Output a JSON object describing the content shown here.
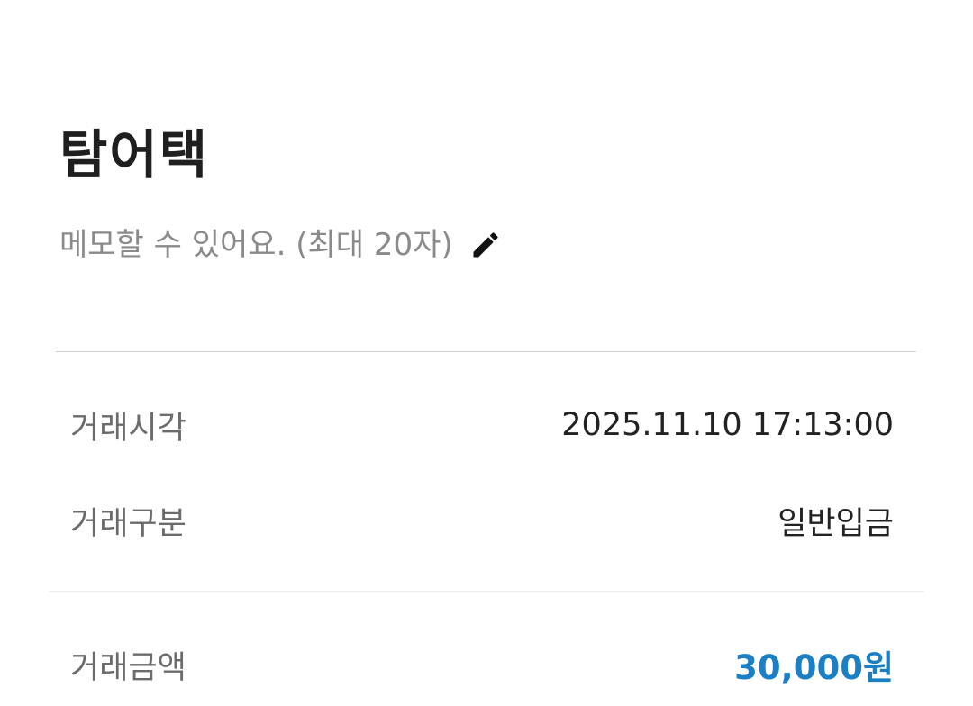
{
  "header": {
    "title": "탐어택"
  },
  "memo": {
    "placeholder": "메모할 수 있어요. (최대 20자)",
    "edit_icon": "pencil-icon"
  },
  "details": {
    "rows": [
      {
        "label": "거래시각",
        "value": "2025.11.10 17:13:00"
      },
      {
        "label": "거래구분",
        "value": "일반입금"
      }
    ],
    "amount": {
      "label": "거래금액",
      "value": "30,000원"
    }
  },
  "colors": {
    "amount": "#1a7fc4",
    "label": "#6b6b6b",
    "memo": "#8a8a8a"
  }
}
